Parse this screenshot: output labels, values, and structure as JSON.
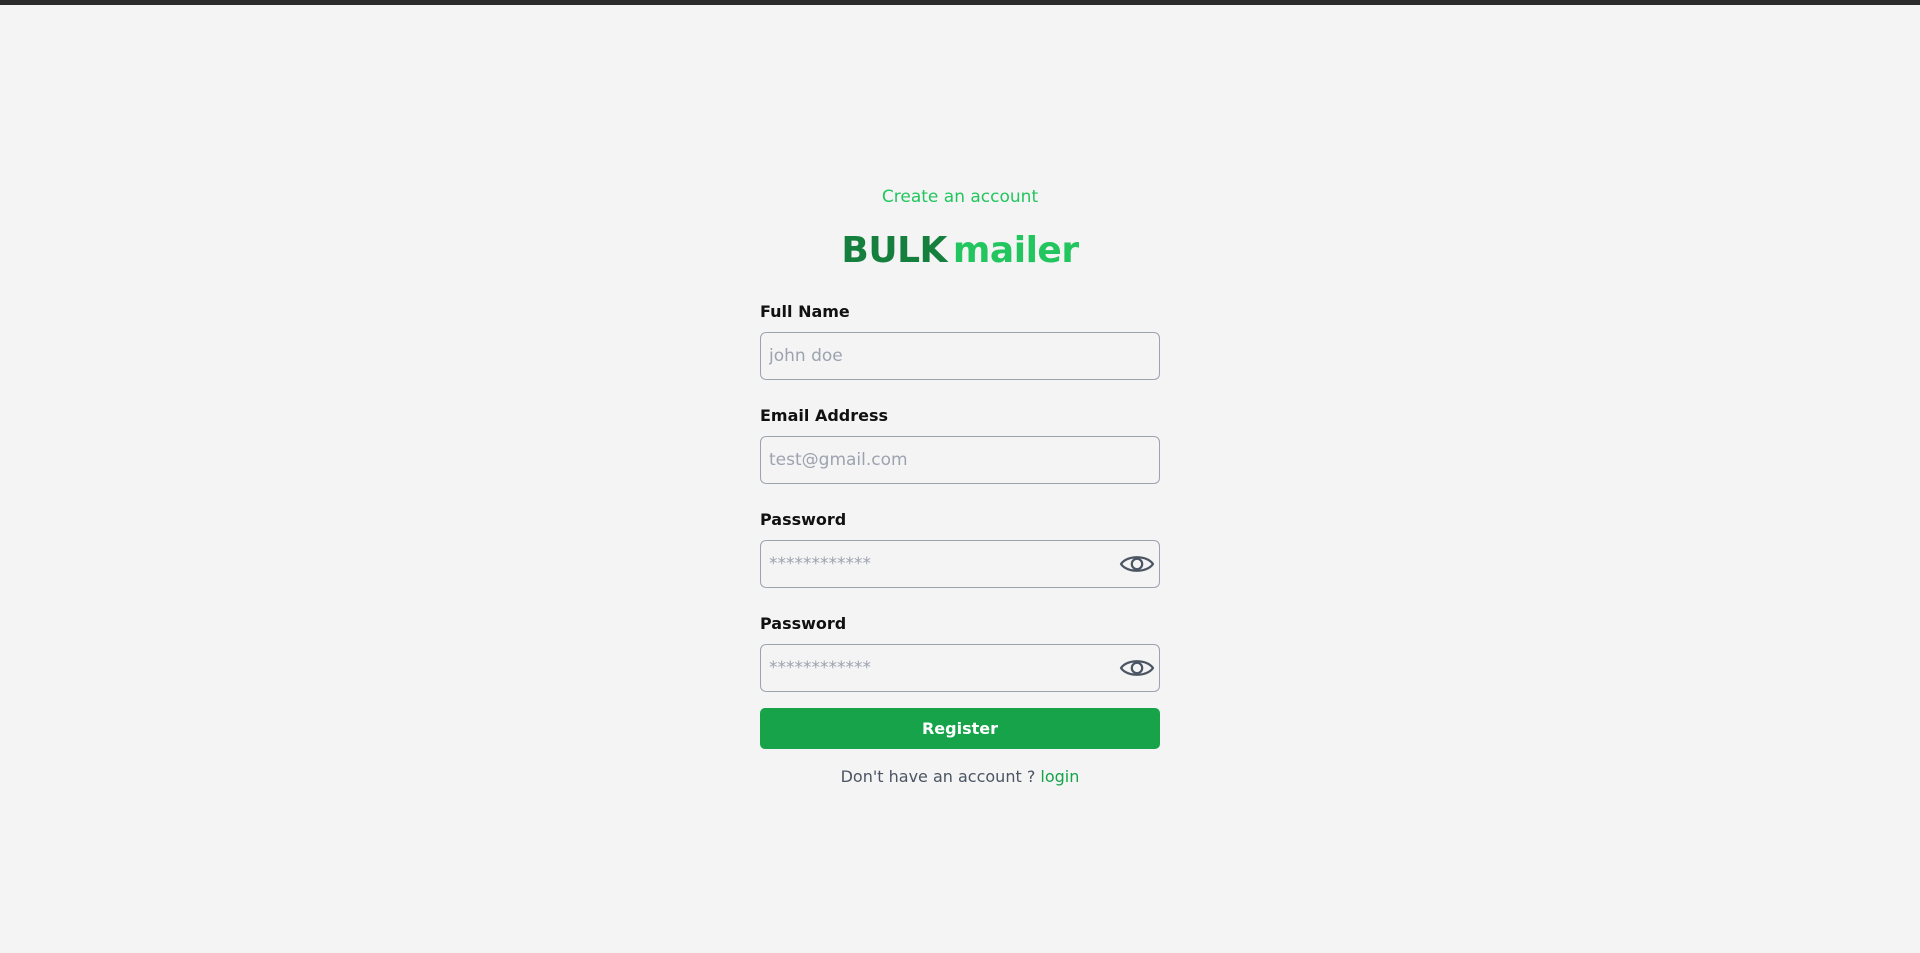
{
  "header": {
    "subtitle": "Create an account",
    "brand_part1": "BULK",
    "brand_part2": "mailer"
  },
  "form": {
    "full_name": {
      "label": "Full Name",
      "placeholder": "john doe",
      "value": ""
    },
    "email": {
      "label": "Email Address",
      "placeholder": "test@gmail.com",
      "value": ""
    },
    "password": {
      "label": "Password",
      "placeholder": "************",
      "value": ""
    },
    "confirm_password": {
      "label": "Password",
      "placeholder": "************",
      "value": ""
    },
    "submit_label": "Register"
  },
  "footer": {
    "prompt": "Don't have an account ?",
    "link_label": "login"
  },
  "icons": {
    "password_toggle": "eye-icon",
    "confirm_password_toggle": "eye-icon"
  },
  "colors": {
    "accent": "#22c55e",
    "brand_dark": "#15803d",
    "button": "#16a34a",
    "background": "#f4f4f4"
  }
}
